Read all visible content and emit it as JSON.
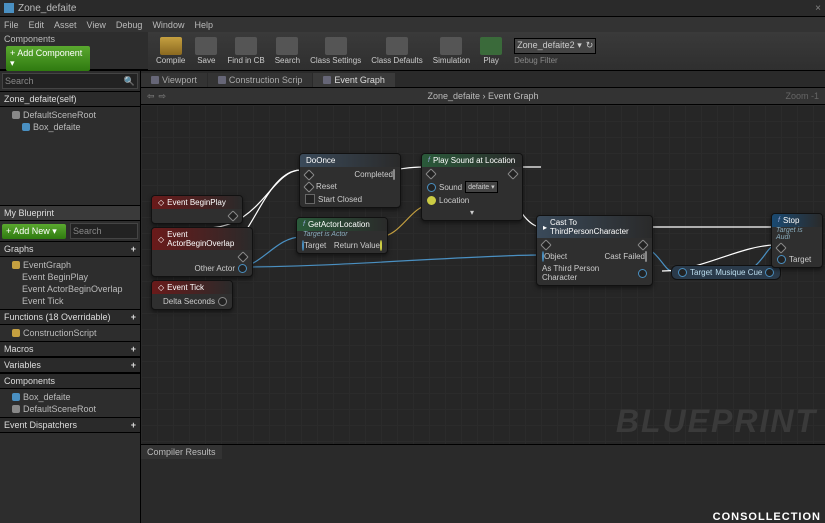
{
  "title": "Zone_defaite",
  "menubar": [
    "File",
    "Edit",
    "Asset",
    "View",
    "Debug",
    "Window",
    "Help"
  ],
  "toolbar": {
    "compile": "Compile",
    "save": "Save",
    "findcb": "Find in CB",
    "search": "Search",
    "classset": "Class Settings",
    "classdef": "Class Defaults",
    "sim": "Simulation",
    "play": "Play",
    "dropdown": "Zone_defaite2 ▾",
    "debugfilter": "Debug Filter"
  },
  "components": {
    "header": "Components",
    "addcomp": "+ Add Component ▾",
    "searchPH": "Search",
    "root": "Zone_defaite(self)",
    "items": [
      "DefaultSceneRoot",
      "Box_defaite"
    ]
  },
  "mybp": {
    "header": "My Blueprint",
    "addnew": "+ Add New ▾",
    "searchPH": "Search",
    "graphs": "Graphs",
    "eventgraph": "EventGraph",
    "egitems": [
      "Event BeginPlay",
      "Event ActorBeginOverlap",
      "Event Tick"
    ],
    "functions": "Functions  (18 Overridable)",
    "construct": "ConstructionScript",
    "macros": "Macros",
    "variables": "Variables",
    "comps": "Components",
    "compitems": [
      "Box_defaite",
      "DefaultSceneRoot"
    ],
    "dispatch": "Event Dispatchers"
  },
  "tabs": {
    "viewport": "Viewport",
    "construct": "Construction Scrip",
    "eventgraph": "Event Graph"
  },
  "crumbs": {
    "back": "⇦",
    "fwd": "⇨",
    "a": "Zone_defaite",
    "b": "Event Graph",
    "zoom": "Zoom -1"
  },
  "nodes": {
    "beginplay": "Event BeginPlay",
    "overlap": "Event ActorBeginOverlap",
    "otheractor": "Other Actor",
    "tick": "Event Tick",
    "delta": "Delta Seconds",
    "doonce": {
      "t": "DoOnce",
      "completed": "Completed",
      "reset": "Reset",
      "startclosed": "Start Closed"
    },
    "getloc": {
      "t": "GetActorLocation",
      "sub": "Target is Actor",
      "target": "Target",
      "ret": "Return Value"
    },
    "playsound": {
      "t": "Play Sound at Location",
      "sound": "Sound",
      "def": "defaite ▾",
      "loc": "Location"
    },
    "cast": {
      "t": "Cast To ThirdPersonCharacter",
      "obj": "Object",
      "failed": "Cast Failed",
      "as": "As Third Person Character"
    },
    "compact": {
      "target": "Target",
      "musique": "Musique Cue"
    },
    "stop": {
      "t": "Stop",
      "sub": "Target is Audi",
      "target": "Target"
    }
  },
  "watermark": "BLUEPRINT",
  "brand": "CONSOLLECTION",
  "compres": "Compiler Results"
}
